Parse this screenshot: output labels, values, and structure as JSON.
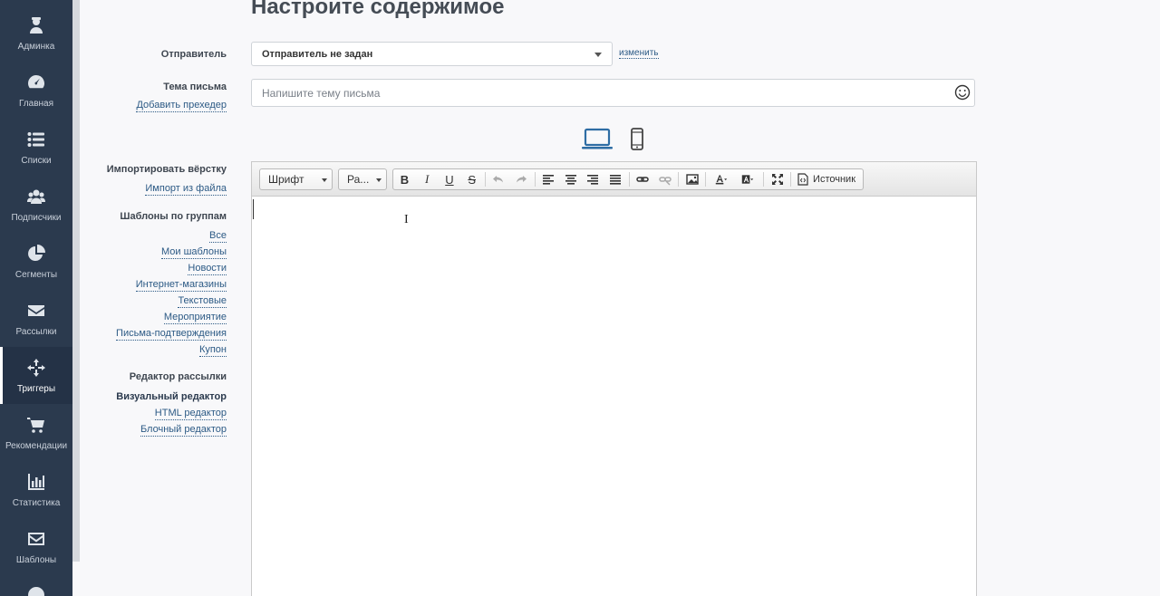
{
  "sidebar": {
    "items": [
      {
        "label": "Админка",
        "icon": "admin-icon"
      },
      {
        "label": "Главная",
        "icon": "dashboard-icon"
      },
      {
        "label": "Списки",
        "icon": "list-icon"
      },
      {
        "label": "Подписчики",
        "icon": "users-icon"
      },
      {
        "label": "Сегменты",
        "icon": "pie-chart-icon"
      },
      {
        "label": "Рассылки",
        "icon": "envelope-icon"
      },
      {
        "label": "Триггеры",
        "icon": "crosshair-icon",
        "active": true
      },
      {
        "label": "Рекомендации",
        "icon": "cart-icon"
      },
      {
        "label": "Статистика",
        "icon": "bar-chart-icon"
      },
      {
        "label": "Шаблоны",
        "icon": "mail-template-icon"
      }
    ]
  },
  "page": {
    "title": "Настроите содержимое"
  },
  "sender": {
    "label": "Отправитель",
    "value": "Отправитель не задан",
    "change_link": "изменить"
  },
  "subject": {
    "label": "Тема письма",
    "preheader_link": "Добавить прехедер",
    "placeholder": "Напишите тему письма"
  },
  "import": {
    "label": "Импортировать вёрстку",
    "file_link": "Импорт из файла"
  },
  "templates": {
    "label": "Шаблоны по группам",
    "groups": [
      "Все",
      "Мои шаблоны",
      "Новости",
      "Интернет-магазины",
      "Текстовые",
      "Мероприятие",
      "Письма-подтверждения",
      "Купон"
    ]
  },
  "editor_mode": {
    "label": "Редактор рассылки",
    "modes": [
      "Визуальный редактор",
      "HTML редактор",
      "Блочный редактор"
    ],
    "selected": "Визуальный редактор"
  },
  "toolbar": {
    "font_label": "Шрифт",
    "size_label": "Ра...",
    "source_label": "Источник"
  },
  "colors": {
    "sidebar": "#2b3a4e",
    "link": "#2c5a85",
    "accent": "#2e6da4"
  }
}
